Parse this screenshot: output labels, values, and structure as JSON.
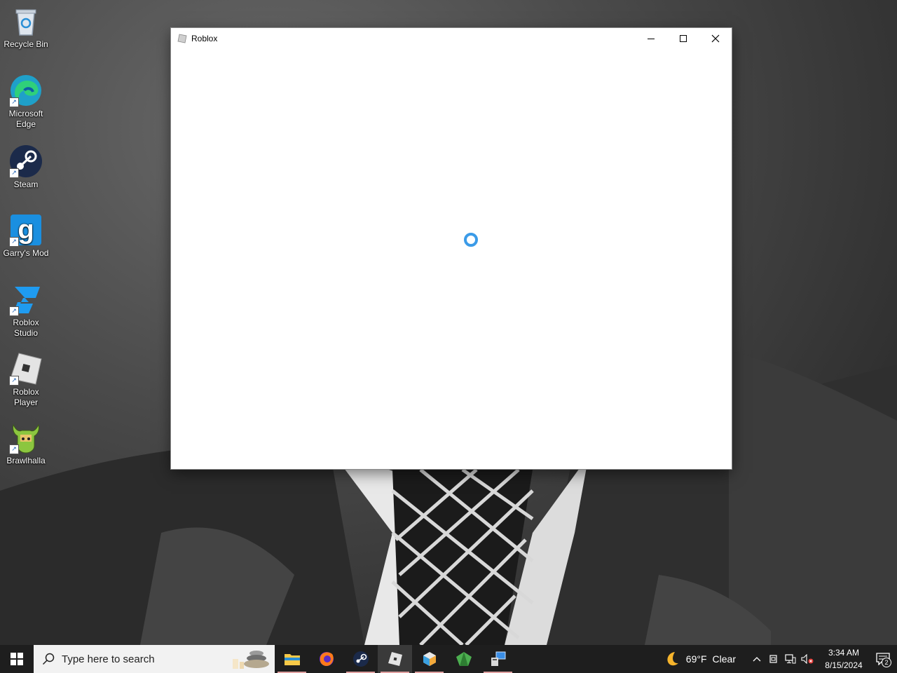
{
  "desktop": {
    "icons": [
      {
        "label": "Recycle Bin",
        "icon": "recycle-bin-icon"
      },
      {
        "label": "Microsoft Edge",
        "icon": "edge-icon"
      },
      {
        "label": "Steam",
        "icon": "steam-icon"
      },
      {
        "label": "Garry's Mod",
        "icon": "garrys-mod-icon"
      },
      {
        "label": "Roblox Studio",
        "icon": "roblox-studio-icon"
      },
      {
        "label": "Roblox Player",
        "icon": "roblox-player-icon"
      },
      {
        "label": "Brawlhalla",
        "icon": "brawlhalla-icon"
      }
    ]
  },
  "window": {
    "title": "Roblox",
    "state": "loading",
    "accent": "#3b9be8"
  },
  "taskbar": {
    "search_placeholder": "Type here to search",
    "apps": [
      "file-explorer",
      "firefox",
      "steam",
      "roblox-player",
      "roblox-studio",
      "green-gem-app",
      "taskmanager-app"
    ],
    "weather": {
      "temp": "69°F",
      "condition": "Clear"
    },
    "clock": {
      "time": "3:34 AM",
      "date": "8/15/2024"
    },
    "notification_count": "2"
  }
}
